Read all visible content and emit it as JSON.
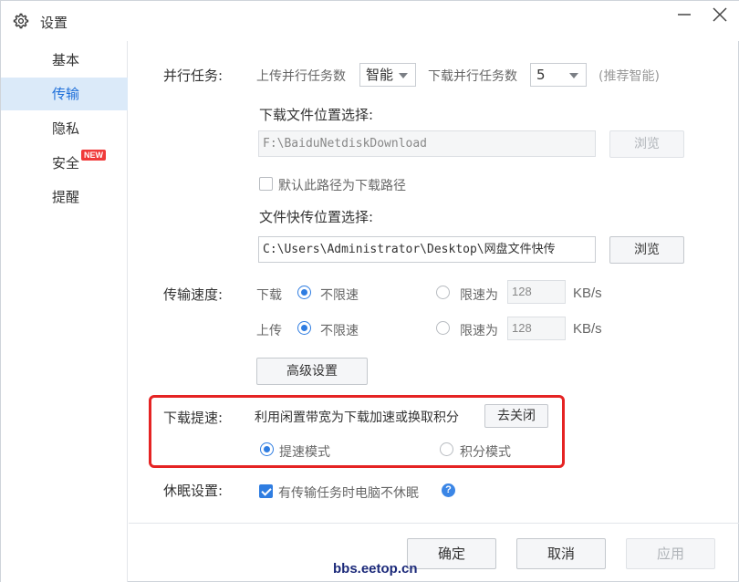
{
  "window": {
    "title": "设置",
    "icons": {
      "settings": "gear-icon",
      "minimize": "minimize-icon",
      "close": "close-icon"
    }
  },
  "sidebar": {
    "items": [
      {
        "label": "基本",
        "active": false
      },
      {
        "label": "传输",
        "active": true
      },
      {
        "label": "隐私",
        "active": false
      },
      {
        "label": "安全",
        "active": false,
        "badge": "NEW"
      },
      {
        "label": "提醒",
        "active": false
      }
    ]
  },
  "parallel": {
    "label": "并行任务:",
    "upload_label": "上传并行任务数",
    "upload_value": "智能",
    "download_label": "下载并行任务数",
    "download_value": "5",
    "hint": "(推荐智能)"
  },
  "download_location": {
    "label": "下载文件位置选择:",
    "path": "F:\\BaiduNetdiskDownload",
    "browse": "浏览",
    "default_checkbox_label": "默认此路径为下载路径",
    "default_checked": false
  },
  "quick_pass": {
    "label": "文件快传位置选择:",
    "path": "C:\\Users\\Administrator\\Desktop\\网盘文件快传",
    "browse": "浏览"
  },
  "speed": {
    "label": "传输速度:",
    "download_label": "下载",
    "upload_label": "上传",
    "unlimited": "不限速",
    "limit_to": "限速为",
    "download_limit": "128",
    "upload_limit": "128",
    "unit": "KB/s",
    "advanced": "高级设置"
  },
  "boost": {
    "label": "下载提速:",
    "description": "利用闲置带宽为下载加速或换取积分",
    "close_button": "去关闭",
    "mode_speed": "提速模式",
    "mode_points": "积分模式",
    "selected": "提速模式"
  },
  "sleep": {
    "label": "休眠设置:",
    "checkbox_label": "有传输任务时电脑不休眠",
    "checked": true
  },
  "footer": {
    "ok": "确定",
    "cancel": "取消",
    "apply": "应用"
  },
  "watermark": "bbs.eetop.cn",
  "colors": {
    "accent": "#2f7de1",
    "highlight": "#e52323",
    "sidebar_active_bg": "#dbeaf9"
  }
}
